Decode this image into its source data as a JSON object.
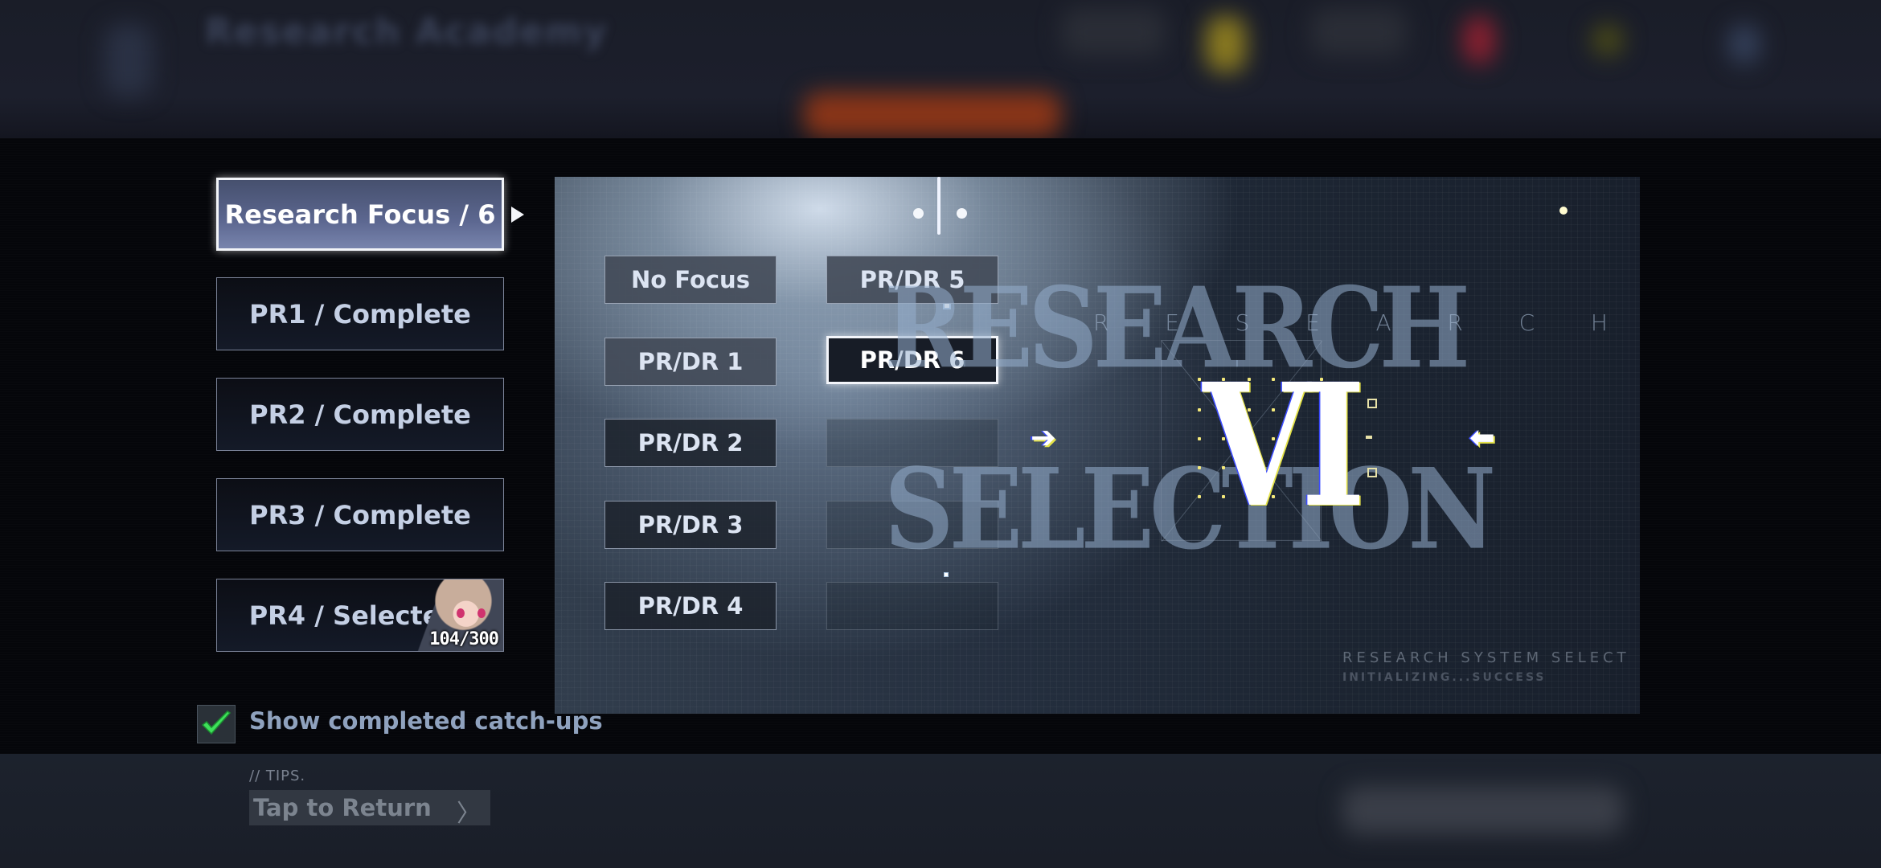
{
  "background_app": {
    "title": "Research Academy"
  },
  "left_menu": {
    "items": [
      {
        "label": "Research Focus / 6",
        "state": "active"
      },
      {
        "label": "PR1 / Complete",
        "state": "complete"
      },
      {
        "label": "PR2 / Complete",
        "state": "complete"
      },
      {
        "label": "PR3 / Complete",
        "state": "complete"
      },
      {
        "label": "PR4 / Selected",
        "state": "selected",
        "progress_text": "104/300",
        "progress_current": 104,
        "progress_total": 300
      }
    ]
  },
  "focus_options": {
    "left_column": [
      "No Focus",
      "PR/DR 1",
      "PR/DR 2",
      "PR/DR 3",
      "PR/DR 4"
    ],
    "right_column": [
      "PR/DR 5",
      "PR/DR 6",
      "",
      "",
      ""
    ],
    "selected": "PR/DR 6"
  },
  "display": {
    "title_line1": "RESEARCH",
    "title_line2": "SELECTION",
    "spaced_letters": [
      "R",
      "E",
      "S",
      "E",
      "A",
      "R",
      "C",
      "H"
    ],
    "selected_numeral": "VI",
    "prev_arrow": "➔",
    "next_arrow": "⬅",
    "system_line1": "RESEARCH SYSTEM SELECT",
    "system_line2": "INITIALIZING...SUCCESS"
  },
  "options": {
    "show_completed_label": "Show completed catch-ups",
    "show_completed_checked": true
  },
  "tips": {
    "label": "// TIPS.",
    "tap_to_return": "Tap to Return",
    "chevron": "〉"
  },
  "colors": {
    "check_green": "#3ee05a",
    "active_button": "#5c6790",
    "accent_yellow": "#e6e44a"
  }
}
